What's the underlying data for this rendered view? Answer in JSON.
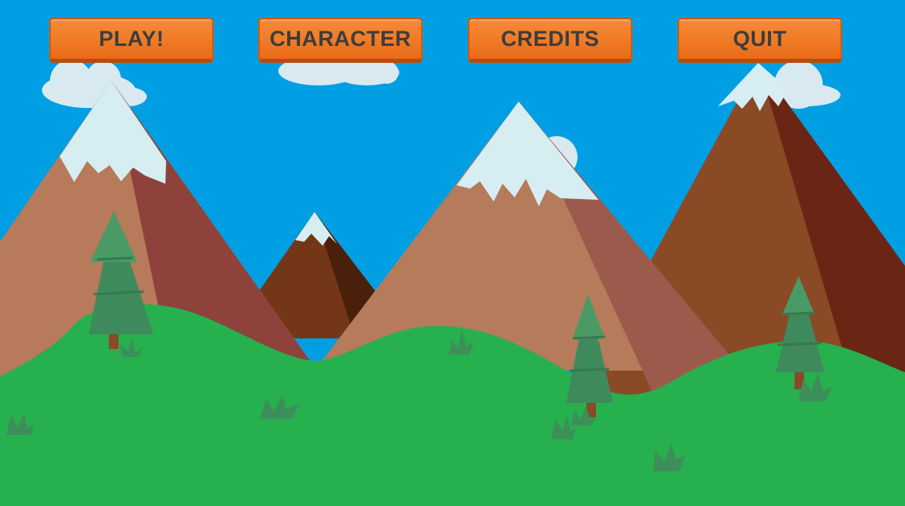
{
  "menu": {
    "play_label": "PLAY!",
    "character_label": "CHARACTER",
    "credits_label": "CREDITS",
    "quit_label": "QUIT"
  },
  "colors": {
    "sky": "#009fe3",
    "grass": "#26b04e",
    "button": "#f07a25",
    "button_text": "#3d3d3d",
    "snow": "#d6edf2",
    "tree": "#3f8a5d"
  }
}
